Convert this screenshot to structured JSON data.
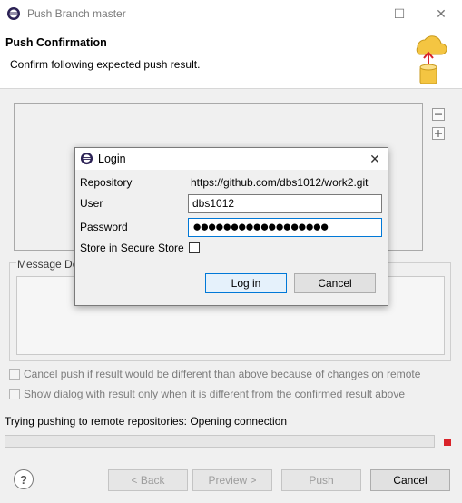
{
  "window": {
    "title": "Push Branch master",
    "header_title": "Push Confirmation",
    "header_subtitle": "Confirm following expected push result."
  },
  "message_details": {
    "legend": "Message De"
  },
  "options": {
    "cancel_if_different": "Cancel push if result would be different than above because of changes on remote",
    "show_dialog_if_different": "Show dialog with result only when it is different from the confirmed result above"
  },
  "status": {
    "text": "Trying pushing to remote repositories: Opening connection"
  },
  "buttons": {
    "back": "< Back",
    "preview": "Preview >",
    "push": "Push",
    "cancel": "Cancel",
    "help": "?"
  },
  "login": {
    "title": "Login",
    "repository_label": "Repository",
    "repository_value": "https://github.com/dbs1012/work2.git",
    "user_label": "User",
    "user_value": "dbs1012",
    "password_label": "Password",
    "password_masked": "●●●●●●●●●●●●●●●●●●",
    "store_label": "Store in Secure Store",
    "login_button": "Log in",
    "cancel_button": "Cancel"
  },
  "icons": {
    "window_close": "✕",
    "window_minimize": "—",
    "window_maximize": "☐",
    "dialog_close": "✕"
  },
  "colors": {
    "accent": "#0078d7",
    "stop": "#d9232a"
  }
}
